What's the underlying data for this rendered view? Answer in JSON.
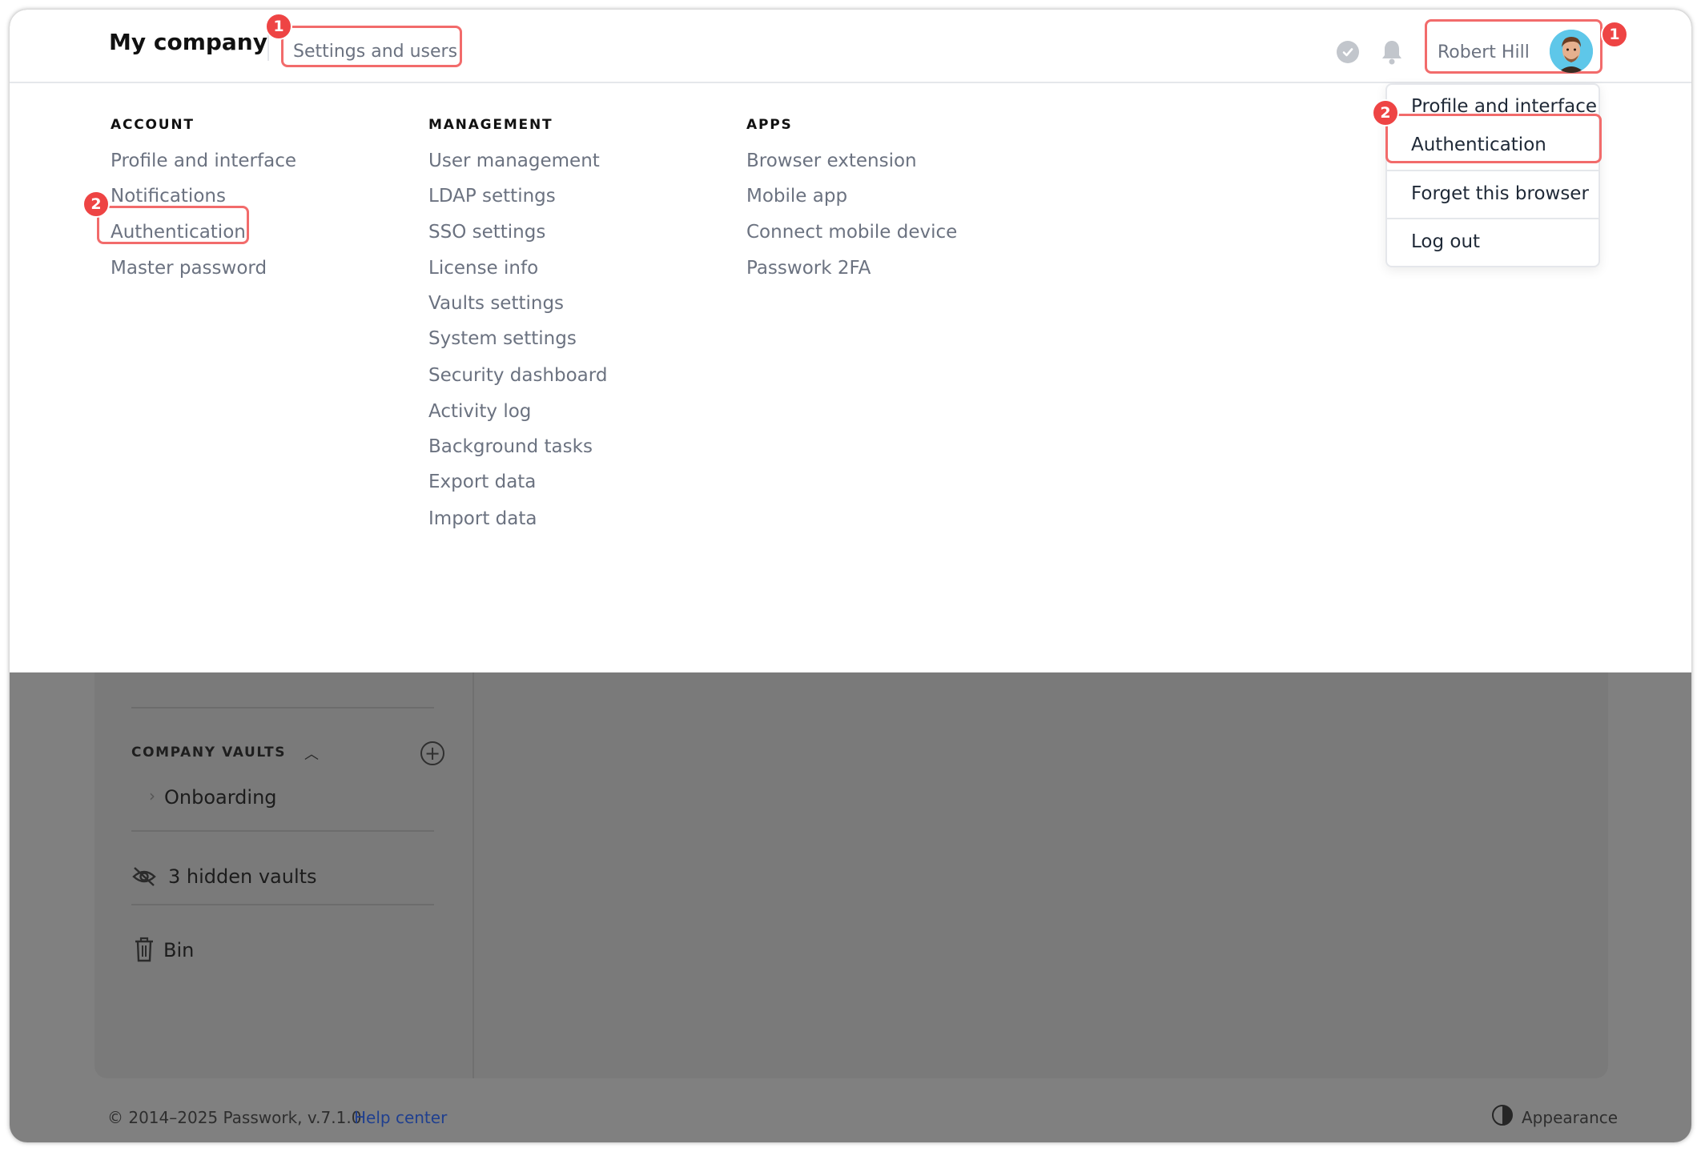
{
  "header": {
    "brand": "My company",
    "settings_link": "Settings and users",
    "user_name": "Robert Hill"
  },
  "annotations": {
    "badge_1": "1",
    "badge_2": "2"
  },
  "menu": {
    "account": {
      "heading": "ACCOUNT",
      "items": [
        "Profile and interface",
        "Notifications",
        "Authentication",
        "Master password"
      ]
    },
    "management": {
      "heading": "MANAGEMENT",
      "items": [
        "User management",
        "LDAP settings",
        "SSO settings",
        "License info",
        "Vaults settings",
        "System settings",
        "Security dashboard",
        "Activity log",
        "Background tasks",
        "Export data",
        "Import data"
      ]
    },
    "apps": {
      "heading": "APPS",
      "items": [
        "Browser extension",
        "Mobile app",
        "Connect mobile device",
        "Passwork 2FA"
      ]
    }
  },
  "user_dropdown": {
    "items": [
      "Profile and interface",
      "Authentication",
      "Forget this browser",
      "Log out"
    ]
  },
  "sidebar": {
    "company_vaults_heading": "COMPANY VAULTS",
    "vault_item": "Onboarding",
    "hidden_vaults": "3 hidden vaults",
    "bin": "Bin"
  },
  "footer": {
    "copyright": "© 2014–2025 Passwork, v.7.1.0",
    "help_link": "Help center",
    "appearance": "Appearance"
  },
  "colors": {
    "highlight": "#f26b6b",
    "badge": "#ee4444",
    "overlay_dim": "#808080",
    "link_gray": "#6b7280"
  }
}
